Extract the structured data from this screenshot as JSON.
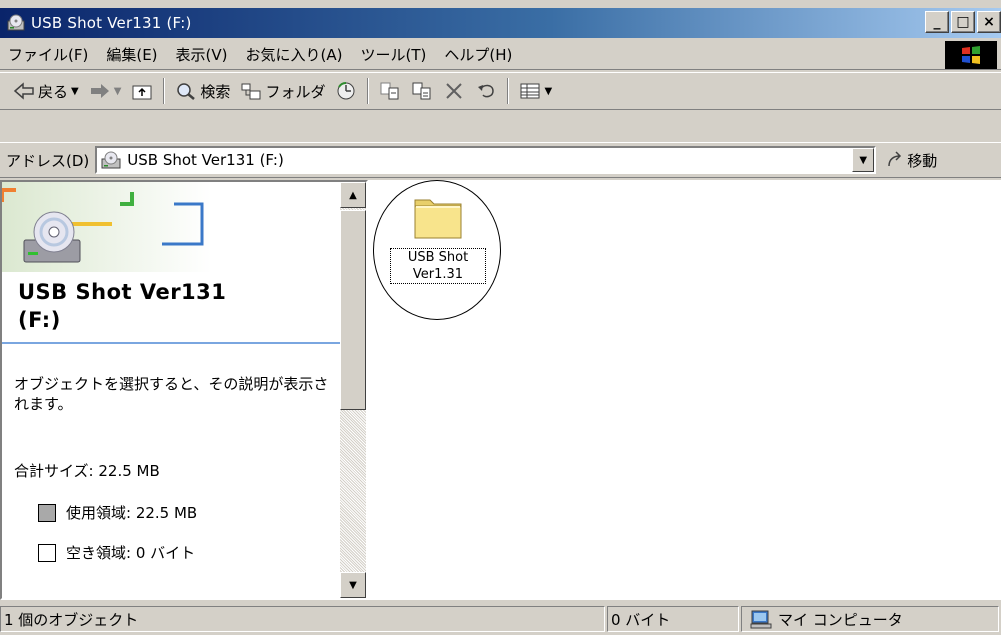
{
  "window": {
    "title": "USB Shot Ver131 (F:)",
    "controls": {
      "minimize": "_",
      "maximize": "□",
      "close": "×"
    }
  },
  "menubar": {
    "items": [
      "ファイル(F)",
      "編集(E)",
      "表示(V)",
      "お気に入り(A)",
      "ツール(T)",
      "ヘルプ(H)"
    ]
  },
  "toolbar": {
    "back_label": "戻る",
    "search_label": "検索",
    "folders_label": "フォルダ"
  },
  "addressbar": {
    "label": "アドレス(D)",
    "value": "USB Shot Ver131 (F:)",
    "go_label": "移動"
  },
  "leftpane": {
    "title_line1": "USB Shot Ver131",
    "title_line2": "(F:)",
    "description": "オブジェクトを選択すると、その説明が表示されます。",
    "total_size": "合計サイズ: 22.5 MB",
    "used_space": "使用領域: 22.5 MB",
    "free_space": "空き領域: 0 バイト"
  },
  "files": [
    {
      "name_line1": "USB Shot",
      "name_line2": "Ver1.31",
      "icon": "folder-icon"
    }
  ],
  "statusbar": {
    "object_count": "1 個のオブジェクト",
    "size": "0 バイト",
    "location": "マイ コンピュータ"
  },
  "colors": {
    "titlebar_start": "#0a246a",
    "titlebar_end": "#a6caf0",
    "face": "#d4d0c8",
    "used_swatch": "#a9a9a9",
    "free_swatch": "#ffffff"
  }
}
